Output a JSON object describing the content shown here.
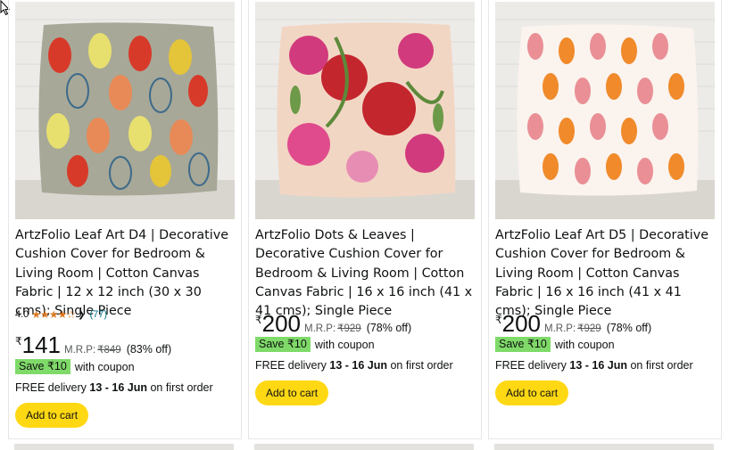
{
  "products": [
    {
      "title": "ArtzFolio Leaf Art D4 | Decorative Cushion Cover for Bedroom & Living Room | Cotton Canvas Fabric | 12 x 12 inch (30 x 30 cms); Single Piece",
      "rating_value": "4.0",
      "rating_stars": "★★★★☆",
      "review_count": "(77)",
      "currency": "₹",
      "price": "141",
      "mrp_label": "M.R.P:",
      "mrp": "₹849",
      "discount": "(83% off)",
      "coupon": "Save ₹10",
      "coupon_suffix": "with coupon",
      "delivery_prefix": "FREE delivery",
      "delivery_dates": "13 - 16 Jun",
      "delivery_suffix": "on first order",
      "button": "Add to cart"
    },
    {
      "title": "ArtzFolio Dots & Leaves | Decorative Cushion Cover for Bedroom & Living Room | Cotton Canvas Fabric | 16 x 16 inch (41 x 41 cms); Single Piece",
      "currency": "₹",
      "price": "200",
      "mrp_label": "M.R.P:",
      "mrp": "₹929",
      "discount": "(78% off)",
      "coupon": "Save ₹10",
      "coupon_suffix": "with coupon",
      "delivery_prefix": "FREE delivery",
      "delivery_dates": "13 - 16 Jun",
      "delivery_suffix": "on first order",
      "button": "Add to cart"
    },
    {
      "title": "ArtzFolio Leaf Art D5 | Decorative Cushion Cover for Bedroom & Living Room | Cotton Canvas Fabric | 16 x 16 inch (41 x 41 cms); Single Piece",
      "currency": "₹",
      "price": "200",
      "mrp_label": "M.R.P:",
      "mrp": "₹929",
      "discount": "(78% off)",
      "coupon": "Save ₹10",
      "coupon_suffix": "with coupon",
      "delivery_prefix": "FREE delivery",
      "delivery_dates": "13 - 16 Jun",
      "delivery_suffix": "on first order",
      "button": "Add to cart"
    }
  ],
  "colors": {
    "button": "#ffd814",
    "coupon_badge": "#7fda69",
    "stars": "#de7921",
    "link": "#007185"
  },
  "icons": {
    "cursor": "mouse-pointer-icon",
    "chevron": "chevron-down-icon"
  }
}
